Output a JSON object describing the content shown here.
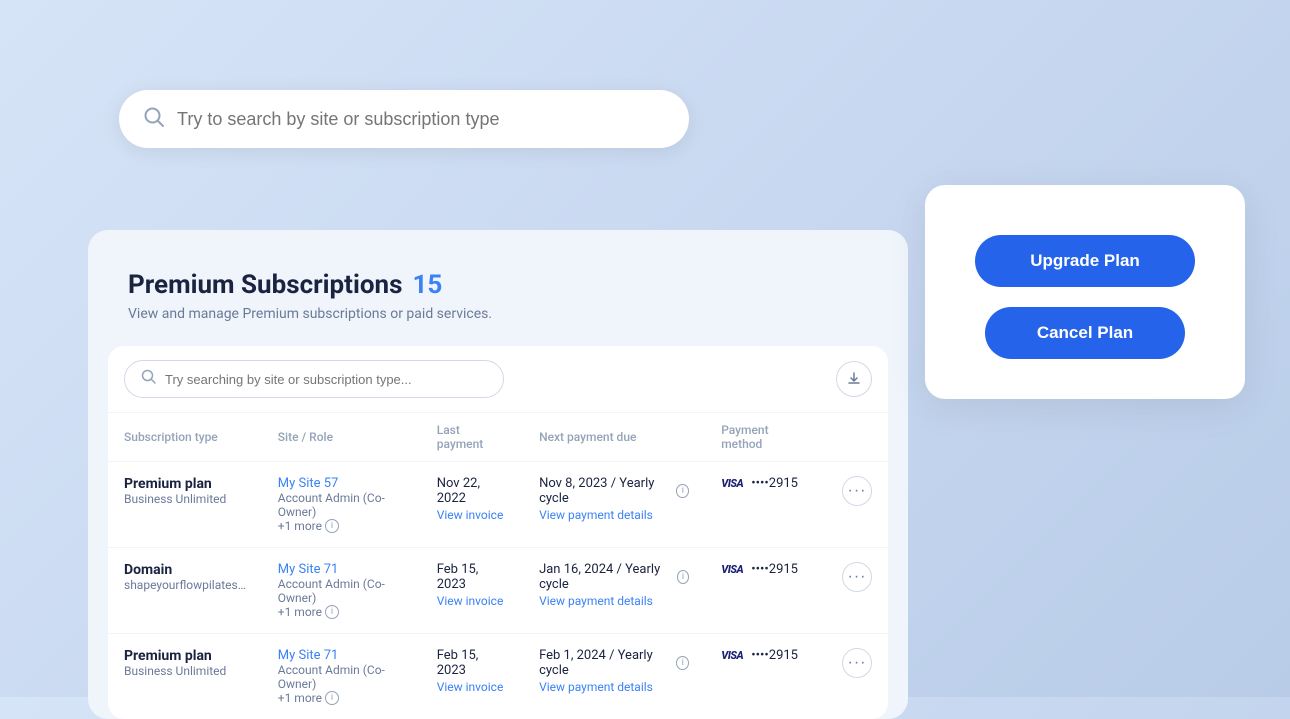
{
  "search": {
    "placeholder": "Try to search by site or subscription type",
    "inner_placeholder": "Try searching by site or subscription type..."
  },
  "page_title": "Premium Subscriptions",
  "page_count": "15",
  "page_subtitle": "View and manage Premium subscriptions or paid services.",
  "table": {
    "columns": [
      "Subscription type",
      "Site / Role",
      "Last payment",
      "Next payment due",
      "Payment method"
    ],
    "rows": [
      {
        "sub_type": "Premium plan",
        "sub_secondary": "Business Unlimited",
        "site_link": "My Site 57",
        "site_role": "Account Admin (Co-Owner)",
        "site_more": "+1 more",
        "last_payment": "Nov 22, 2022",
        "view_invoice": "View invoice",
        "next_payment": "Nov 8, 2023 / Yearly cycle",
        "view_payment_details": "View payment details",
        "payment_method": "VISA",
        "card_last4": "••••2915"
      },
      {
        "sub_type": "Domain",
        "sub_secondary": "shapeyourflowpilates…",
        "site_link": "My Site 71",
        "site_role": "Account Admin (Co-Owner)",
        "site_more": "+1 more",
        "last_payment": "Feb 15, 2023",
        "view_invoice": "View invoice",
        "next_payment": "Jan 16, 2024 / Yearly cycle",
        "view_payment_details": "View payment details",
        "payment_method": "VISA",
        "card_last4": "••••2915"
      },
      {
        "sub_type": "Premium plan",
        "sub_secondary": "Business Unlimited",
        "site_link": "My Site 71",
        "site_role": "Account Admin (Co-Owner)",
        "site_more": "+1 more",
        "last_payment": "Feb 15, 2023",
        "view_invoice": "View invoice",
        "next_payment": "Feb 1, 2024 / Yearly cycle",
        "view_payment_details": "View payment details",
        "payment_method": "VISA",
        "card_last4": "••••2915"
      }
    ]
  },
  "actions": {
    "upgrade_label": "Upgrade Plan",
    "cancel_label": "Cancel Plan"
  },
  "icons": {
    "search": "🔍",
    "download": "⬇",
    "more": "···",
    "info": "i"
  }
}
